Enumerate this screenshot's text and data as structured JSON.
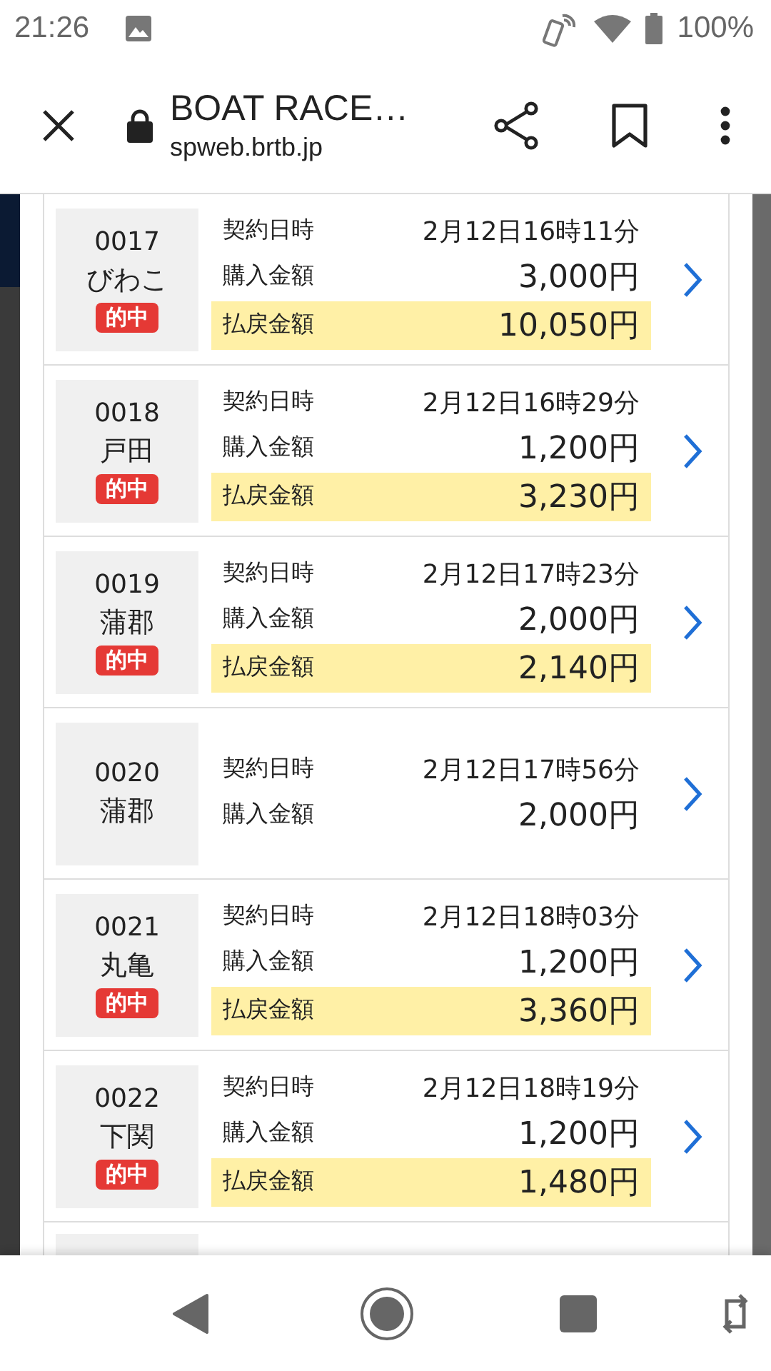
{
  "status_bar": {
    "time": "21:26",
    "battery": "100%"
  },
  "toolbar": {
    "title": "BOAT RACE…",
    "url": "spweb.brtb.jp"
  },
  "tickets": [
    {
      "kind": "full",
      "number": "0017",
      "venue": "びわこ",
      "hit": true,
      "hit_label": "的中",
      "date_label": "契約日時",
      "date": "2月12日16時11分",
      "purchase_label": "購入金額",
      "purchase": "3,000円",
      "payout_label": "払戻金額",
      "payout": "10,050円"
    },
    {
      "kind": "full",
      "number": "0018",
      "venue": "戸田",
      "hit": true,
      "hit_label": "的中",
      "date_label": "契約日時",
      "date": "2月12日16時29分",
      "purchase_label": "購入金額",
      "purchase": "1,200円",
      "payout_label": "払戻金額",
      "payout": "3,230円"
    },
    {
      "kind": "full",
      "number": "0019",
      "venue": "蒲郡",
      "hit": true,
      "hit_label": "的中",
      "date_label": "契約日時",
      "date": "2月12日17時23分",
      "purchase_label": "購入金額",
      "purchase": "2,000円",
      "payout_label": "払戻金額",
      "payout": "2,140円"
    },
    {
      "kind": "full",
      "number": "0020",
      "venue": "蒲郡",
      "hit": false,
      "date_label": "契約日時",
      "date": "2月12日17時56分",
      "purchase_label": "購入金額",
      "purchase": "2,000円"
    },
    {
      "kind": "full",
      "number": "0021",
      "venue": "丸亀",
      "hit": true,
      "hit_label": "的中",
      "date_label": "契約日時",
      "date": "2月12日18時03分",
      "purchase_label": "購入金額",
      "purchase": "1,200円",
      "payout_label": "払戻金額",
      "payout": "3,360円"
    },
    {
      "kind": "full",
      "number": "0022",
      "venue": "下関",
      "hit": true,
      "hit_label": "的中",
      "date_label": "契約日時",
      "date": "2月12日18時19分",
      "purchase_label": "購入金額",
      "purchase": "1,200円",
      "payout_label": "払戻金額",
      "payout": "1,480円"
    },
    {
      "kind": "cut"
    }
  ]
}
